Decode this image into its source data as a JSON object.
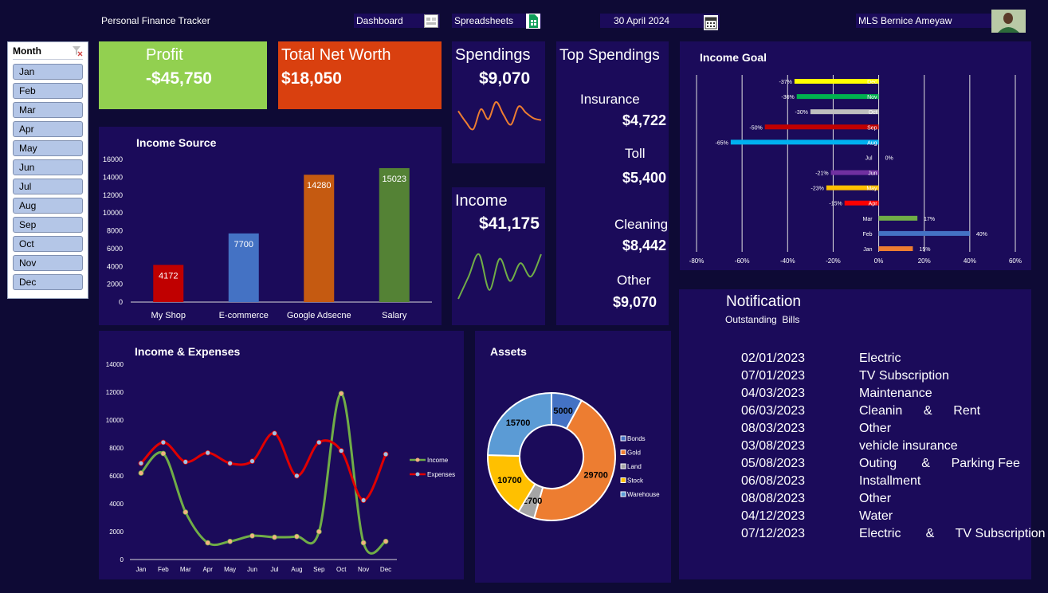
{
  "header": {
    "app_title": "Personal Finance Tracker",
    "dashboard_label": "Dashboard",
    "spreadsheets_label": "Spreadsheets",
    "date": "30 April 2024",
    "user_name": "MLS Bernice Ameyaw"
  },
  "slicer": {
    "title": "Month",
    "items": [
      "Jan",
      "Feb",
      "Mar",
      "Apr",
      "May",
      "Jun",
      "Jul",
      "Aug",
      "Sep",
      "Oct",
      "Nov",
      "Dec"
    ]
  },
  "kpis": {
    "profit_label": "Profit",
    "profit_value": "-$45,750",
    "networth_label": "Total Net Worth",
    "networth_value": "$18,050",
    "spendings_label": "Spendings",
    "spendings_value": "$9,070",
    "income_label": "Income",
    "income_value": "$41,175"
  },
  "top_spendings": {
    "title": "Top Spendings",
    "items": [
      {
        "label": "Insurance",
        "value": "$4,722"
      },
      {
        "label": "Toll",
        "value": "$5,400"
      },
      {
        "label": "Cleaning",
        "value": "$8,442"
      },
      {
        "label": "Other",
        "value": "$9,070"
      }
    ]
  },
  "notification": {
    "title": "Notification",
    "subtitle": "Outstanding  Bills",
    "bills": [
      {
        "date": "02/01/2023",
        "desc": "Electric"
      },
      {
        "date": "07/01/2023",
        "desc": "TV Subscription"
      },
      {
        "date": "04/03/2023",
        "desc": "Maintenance"
      },
      {
        "date": "06/03/2023",
        "desc": "Cleanin      &      Rent"
      },
      {
        "date": "08/03/2023",
        "desc": "Other"
      },
      {
        "date": "03/08/2023",
        "desc": "vehicle insurance"
      },
      {
        "date": "05/08/2023",
        "desc": "Outing       &      Parking Fee"
      },
      {
        "date": "06/08/2023",
        "desc": "Installment"
      },
      {
        "date": "08/08/2023",
        "desc": "Other"
      },
      {
        "date": "04/12/2023",
        "desc": "Water"
      },
      {
        "date": "07/12/2023",
        "desc": "Electric       &      TV Subscription"
      }
    ]
  },
  "colors": {
    "background": "#0e0a35",
    "panel": "#1b0b5a",
    "profit": "#92d050",
    "networth": "#d9400f",
    "income_line": "#70ad47",
    "expenses_line": "#e00000"
  },
  "chart_data": [
    {
      "id": "income_source",
      "type": "bar",
      "title": "Income Source",
      "categories": [
        "My Shop",
        "E-commerce",
        "Google Adsecne",
        "Salary"
      ],
      "values": [
        4172,
        7700,
        14280,
        15023
      ],
      "colors": [
        "#c00000",
        "#4472c4",
        "#c55a11",
        "#548235"
      ],
      "ylim": [
        0,
        16000
      ],
      "yticks": [
        0,
        2000,
        4000,
        6000,
        8000,
        10000,
        12000,
        14000,
        16000
      ],
      "grid": false
    },
    {
      "id": "spendings_spark",
      "type": "line",
      "values": [
        50,
        38,
        30,
        52,
        41,
        60,
        46,
        35,
        55,
        48,
        42,
        40
      ],
      "color": "#ed7d31"
    },
    {
      "id": "income_spark",
      "type": "line",
      "values": [
        20,
        45,
        70,
        30,
        65,
        40,
        60,
        45,
        70
      ],
      "color": "#70ad47"
    },
    {
      "id": "income_goal",
      "type": "bar",
      "orientation": "horizontal",
      "title": "Income Goal",
      "categories": [
        "Dec",
        "Nov",
        "Oct",
        "Sep",
        "Aug",
        "Jul",
        "Jun",
        "May",
        "Apr",
        "Mar",
        "Feb",
        "Jan"
      ],
      "values": [
        -37,
        -36,
        -30,
        -50,
        -65,
        0,
        -21,
        -23,
        -15,
        17,
        40,
        15
      ],
      "labels": [
        "-37%",
        "-36%",
        "-30%",
        "-50%",
        "-65%",
        "0%",
        "-21%",
        "-23%",
        "-15%",
        "17%",
        "40%",
        "15%"
      ],
      "colors": [
        "#ffff00",
        "#00b050",
        "#bfbfbf",
        "#c00000",
        "#00b0f0",
        "#7030a0",
        "#7030a0",
        "#ffc000",
        "#ff0000",
        "#70ad47",
        "#4472c4",
        "#ed7d31"
      ],
      "xlim": [
        -80,
        60
      ],
      "xticks": [
        -80,
        -60,
        -40,
        -20,
        0,
        20,
        40,
        60
      ],
      "xtick_labels": [
        "-80%",
        "-60%",
        "-40%",
        "-20%",
        "0%",
        "20%",
        "40%",
        "60%"
      ],
      "grid": true
    },
    {
      "id": "income_expenses",
      "type": "line",
      "title": "Income & Expenses",
      "categories": [
        "Jan",
        "Feb",
        "Mar",
        "Apr",
        "May",
        "Jun",
        "Jul",
        "Aug",
        "Sep",
        "Oct",
        "Nov",
        "Dec"
      ],
      "series": [
        {
          "name": "Income",
          "values": [
            6200,
            7600,
            3400,
            1200,
            1300,
            1700,
            1600,
            1650,
            2000,
            11900,
            1200,
            1300
          ],
          "color": "#70ad47"
        },
        {
          "name": "Expenses",
          "values": [
            6900,
            8400,
            7000,
            7650,
            6900,
            7050,
            9050,
            6000,
            8400,
            7800,
            4250,
            7550
          ],
          "color": "#e00000"
        }
      ],
      "ylim": [
        0,
        14000
      ],
      "yticks": [
        0,
        2000,
        4000,
        6000,
        8000,
        10000,
        12000,
        14000
      ],
      "legend": "right"
    },
    {
      "id": "assets",
      "type": "pie",
      "title": "Assets",
      "categories": [
        "Bonds",
        "Gold",
        "Land",
        "Stock",
        "Warehouse"
      ],
      "values": [
        5000,
        29700,
        2700,
        10700,
        15700
      ],
      "colors": [
        "#4472c4",
        "#ed7d31",
        "#a5a5a5",
        "#ffc000",
        "#5b9bd5"
      ],
      "legend": "right"
    }
  ]
}
